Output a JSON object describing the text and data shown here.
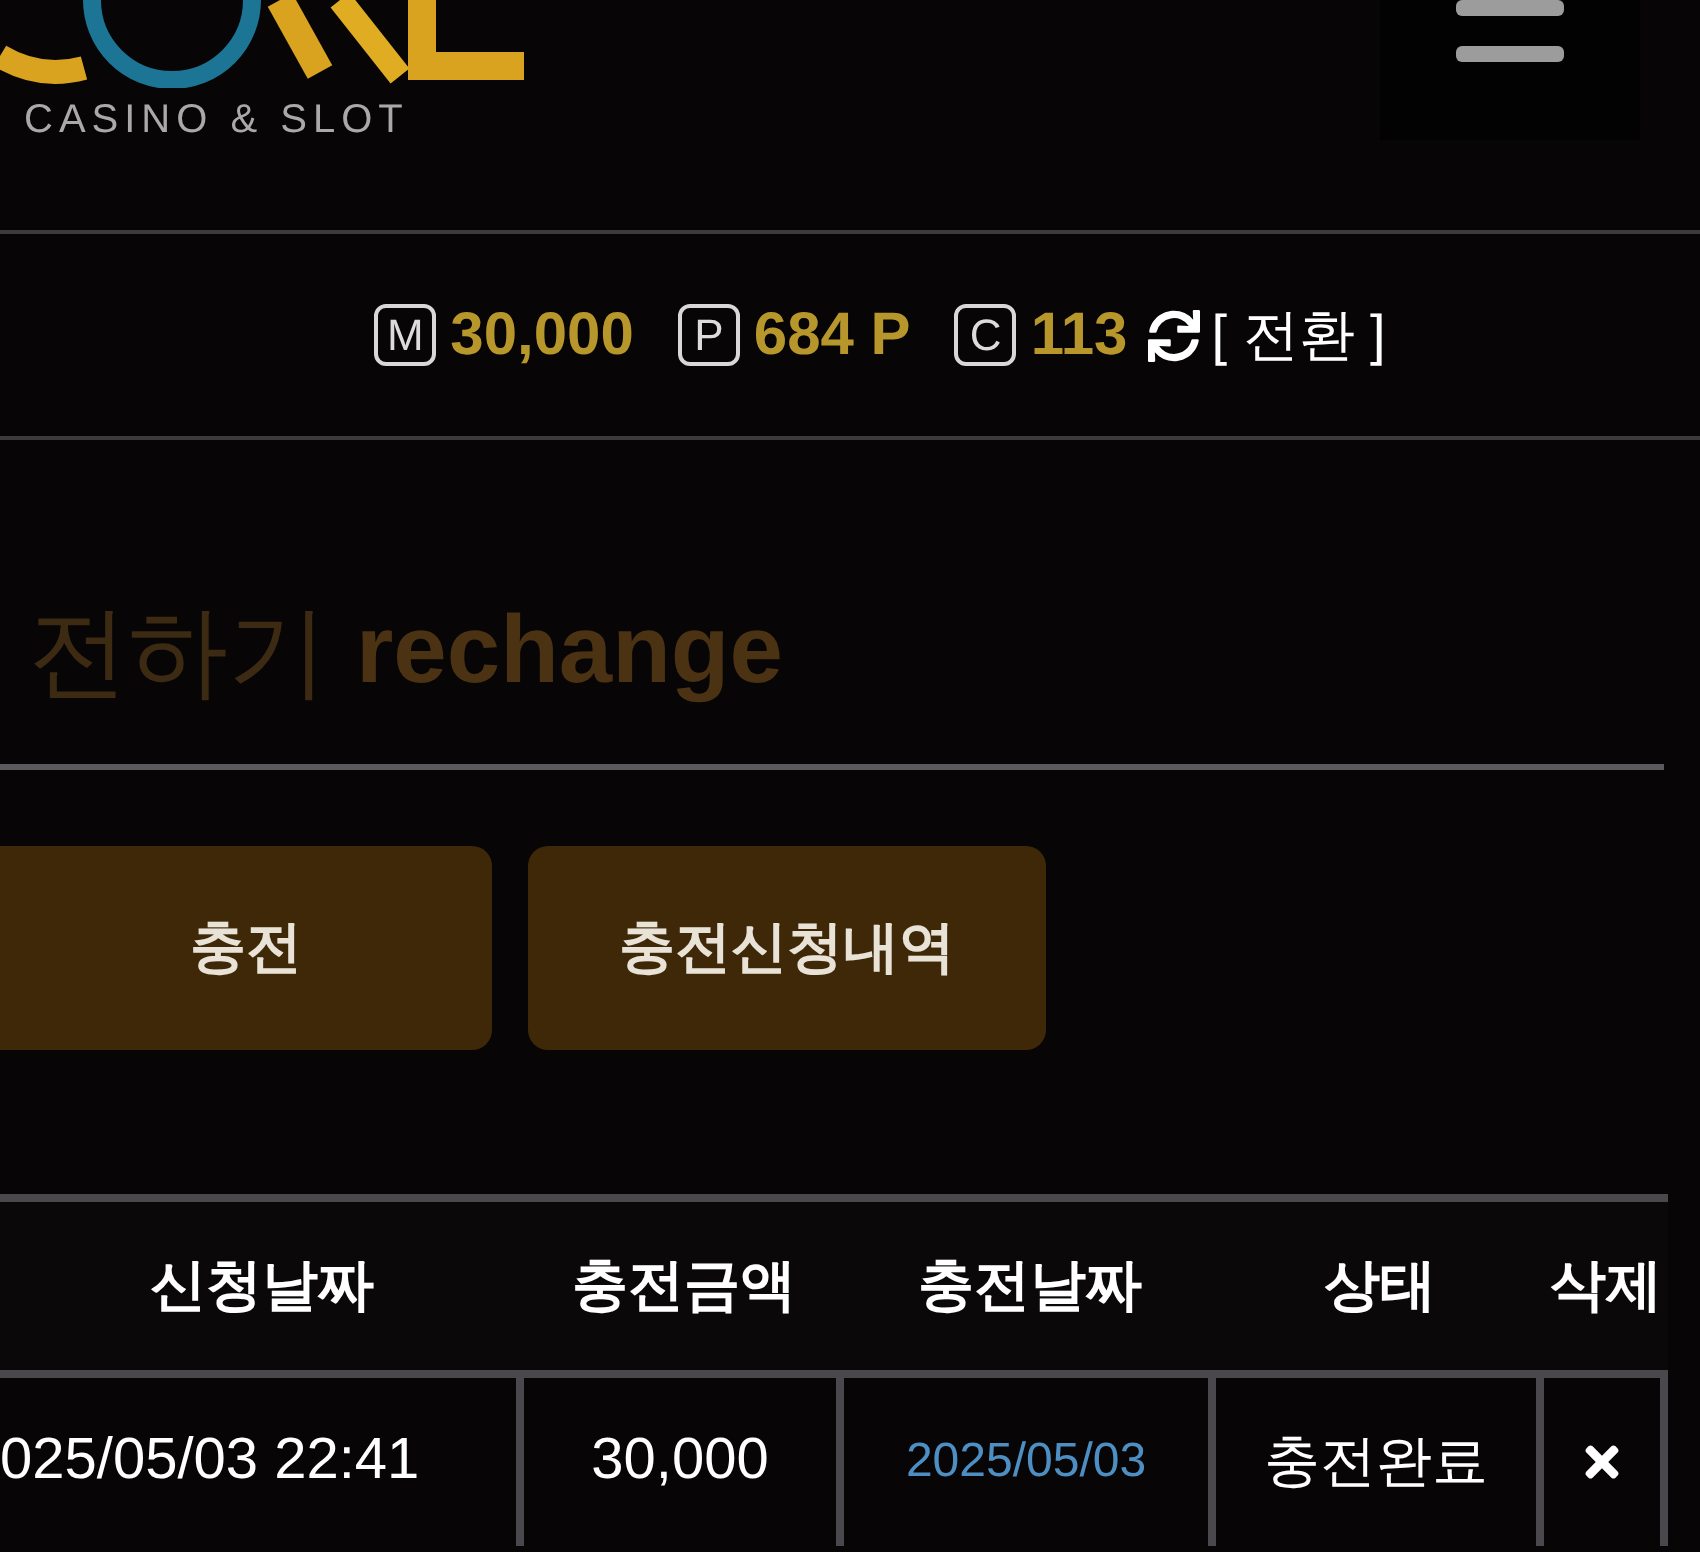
{
  "header": {
    "logo_tagline": "CASINO & SLOT"
  },
  "balances": [
    {
      "badge": "M",
      "value": "30,000"
    },
    {
      "badge": "P",
      "value": "684 P"
    },
    {
      "badge": "C",
      "value": "113"
    }
  ],
  "convert_link": "[ 전환 ]",
  "page_title": {
    "korean": "전하기",
    "english": "rechange"
  },
  "tabs": [
    {
      "label": "충전"
    },
    {
      "label": "충전신청내역"
    }
  ],
  "table": {
    "columns": [
      "신청날짜",
      "충전금액",
      "충전날짜",
      "상태",
      "삭제"
    ],
    "rows": [
      {
        "requested": "025/05/03 22:41",
        "amount": "30,000",
        "charged_date": "2025/05/03",
        "status": "충전완료"
      }
    ]
  }
}
